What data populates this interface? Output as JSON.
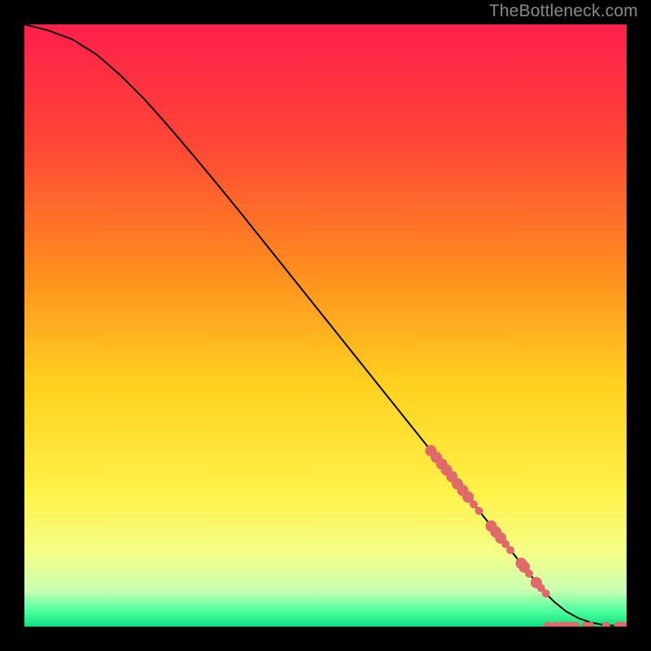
{
  "attribution": "TheBottleneck.com",
  "chart_data": {
    "type": "line",
    "title": "",
    "xlabel": "",
    "ylabel": "",
    "xlim": [
      0,
      100
    ],
    "ylim": [
      0,
      100
    ],
    "background_gradient": {
      "stops": [
        {
          "offset": 0.0,
          "color": "#ff1f4b"
        },
        {
          "offset": 0.2,
          "color": "#ff4736"
        },
        {
          "offset": 0.4,
          "color": "#ff8a1f"
        },
        {
          "offset": 0.6,
          "color": "#ffd21f"
        },
        {
          "offset": 0.78,
          "color": "#fff24a"
        },
        {
          "offset": 0.88,
          "color": "#f4ff8a"
        },
        {
          "offset": 0.94,
          "color": "#c8ffb2"
        },
        {
          "offset": 0.975,
          "color": "#4bff9e"
        },
        {
          "offset": 1.0,
          "color": "#0be081"
        }
      ]
    },
    "series": [
      {
        "name": "bottleneck-curve",
        "color": "#000000",
        "x": [
          0,
          4,
          8,
          12,
          16,
          20,
          24,
          28,
          32,
          36,
          40,
          44,
          48,
          52,
          56,
          60,
          64,
          68,
          72,
          76,
          78,
          80,
          82,
          84,
          86,
          88,
          90,
          92,
          94,
          96,
          98,
          100
        ],
        "y": [
          100,
          99,
          97.5,
          95,
          91.5,
          87.5,
          83,
          78.3,
          73.5,
          68.6,
          63.6,
          58.6,
          53.6,
          48.6,
          43.6,
          38.6,
          33.6,
          28.6,
          23.6,
          18.6,
          16.1,
          13.6,
          11.1,
          8.6,
          6.1,
          4.1,
          2.5,
          1.4,
          0.7,
          0.3,
          0.15,
          0.1
        ]
      }
    ],
    "scatter_points": {
      "name": "highlighted-range",
      "color": "#e06a6a",
      "radius_small": 5,
      "radius_medium": 7,
      "points": [
        {
          "x": 67.5,
          "y": 29.2,
          "r": 7
        },
        {
          "x": 68.4,
          "y": 28.1,
          "r": 7
        },
        {
          "x": 69.3,
          "y": 27.0,
          "r": 7
        },
        {
          "x": 70.1,
          "y": 26.0,
          "r": 7
        },
        {
          "x": 71.0,
          "y": 24.9,
          "r": 7
        },
        {
          "x": 71.9,
          "y": 23.7,
          "r": 7
        },
        {
          "x": 72.8,
          "y": 22.6,
          "r": 7
        },
        {
          "x": 73.7,
          "y": 21.5,
          "r": 7
        },
        {
          "x": 74.6,
          "y": 20.3,
          "r": 5
        },
        {
          "x": 75.5,
          "y": 19.2,
          "r": 5
        },
        {
          "x": 77.5,
          "y": 16.7,
          "r": 7
        },
        {
          "x": 78.3,
          "y": 15.7,
          "r": 7
        },
        {
          "x": 79.1,
          "y": 14.7,
          "r": 7
        },
        {
          "x": 79.9,
          "y": 13.7,
          "r": 5
        },
        {
          "x": 80.7,
          "y": 12.7,
          "r": 5
        },
        {
          "x": 82.5,
          "y": 10.5,
          "r": 7
        },
        {
          "x": 83.0,
          "y": 9.9,
          "r": 7
        },
        {
          "x": 83.8,
          "y": 8.8,
          "r": 5
        },
        {
          "x": 85.0,
          "y": 7.3,
          "r": 7
        },
        {
          "x": 85.8,
          "y": 6.4,
          "r": 5
        },
        {
          "x": 86.6,
          "y": 5.5,
          "r": 5
        },
        {
          "x": 86.9,
          "y": 0.15,
          "r": 5
        },
        {
          "x": 88.1,
          "y": 0.15,
          "r": 5
        },
        {
          "x": 89.0,
          "y": 0.15,
          "r": 5
        },
        {
          "x": 89.9,
          "y": 0.15,
          "r": 5
        },
        {
          "x": 90.7,
          "y": 0.15,
          "r": 5
        },
        {
          "x": 91.5,
          "y": 0.15,
          "r": 5
        },
        {
          "x": 93.2,
          "y": 0.15,
          "r": 5
        },
        {
          "x": 94.0,
          "y": 0.15,
          "r": 5
        },
        {
          "x": 96.6,
          "y": 0.15,
          "r": 5
        },
        {
          "x": 98.6,
          "y": 0.15,
          "r": 5
        },
        {
          "x": 99.4,
          "y": 0.15,
          "r": 5
        }
      ]
    }
  }
}
